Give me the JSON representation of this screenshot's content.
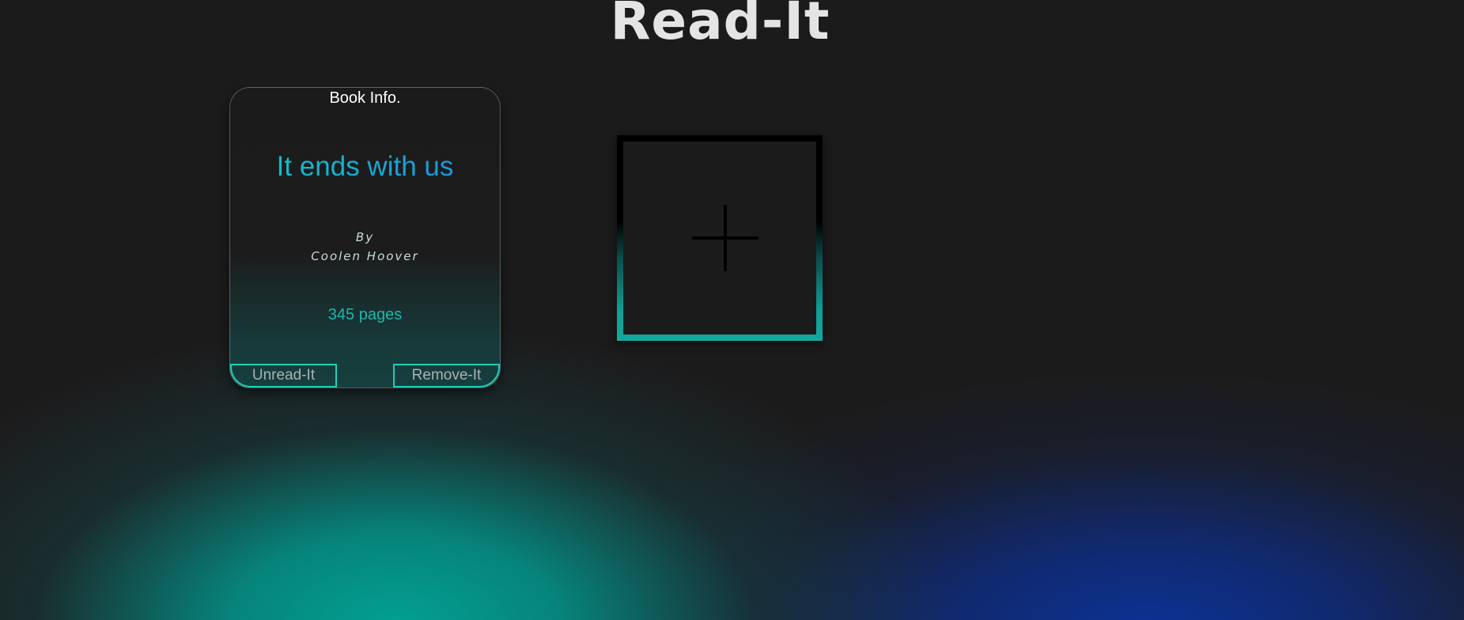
{
  "app": {
    "title": "Read-It"
  },
  "book_card": {
    "heading": "Book Info.",
    "title": "It ends with us",
    "by_label": "By",
    "author": "Coolen Hoover",
    "pages": "345 pages",
    "unread_button": "Unread-It",
    "remove_button": "Remove-It"
  },
  "add_book": {
    "icon": "plus-icon"
  },
  "colors": {
    "background": "#1c1b1c",
    "accent_teal": "#1ecfb7",
    "title_gradient_start": "#10c7c4",
    "title_gradient_end": "#1f8de0",
    "glow_teal": "#02a091",
    "glow_blue": "#0c3296"
  }
}
